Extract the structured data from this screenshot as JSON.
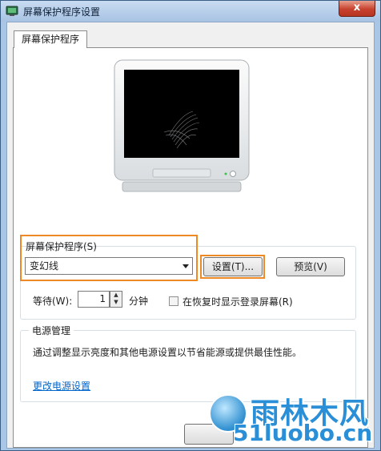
{
  "window": {
    "title": "屏幕保护程序设置",
    "close_glyph": "x",
    "close_color": "#c7422e"
  },
  "tab": {
    "label": "屏幕保护程序"
  },
  "screensaver": {
    "group_label": "屏幕保护程序(S)",
    "selected": "变幻线",
    "settings_button": "设置(T)...",
    "preview_button": "预览(V)",
    "wait_label": "等待(W):",
    "wait_value": "1",
    "wait_unit": "分钟",
    "resume_checkbox_label": "在恢复时显示登录屏幕(R)",
    "resume_checked": false,
    "highlight_color": "#ee8a26"
  },
  "power": {
    "group_label": "电源管理",
    "description": "通过调整显示亮度和其他电源设置以节省能源或提供最佳性能。",
    "link": "更改电源设置"
  },
  "watermark": {
    "brand": "雨林木风",
    "url": "51luobo.cn"
  },
  "icons": {
    "app": "screensaver-settings-icon",
    "monitor": "monitor-preview"
  }
}
